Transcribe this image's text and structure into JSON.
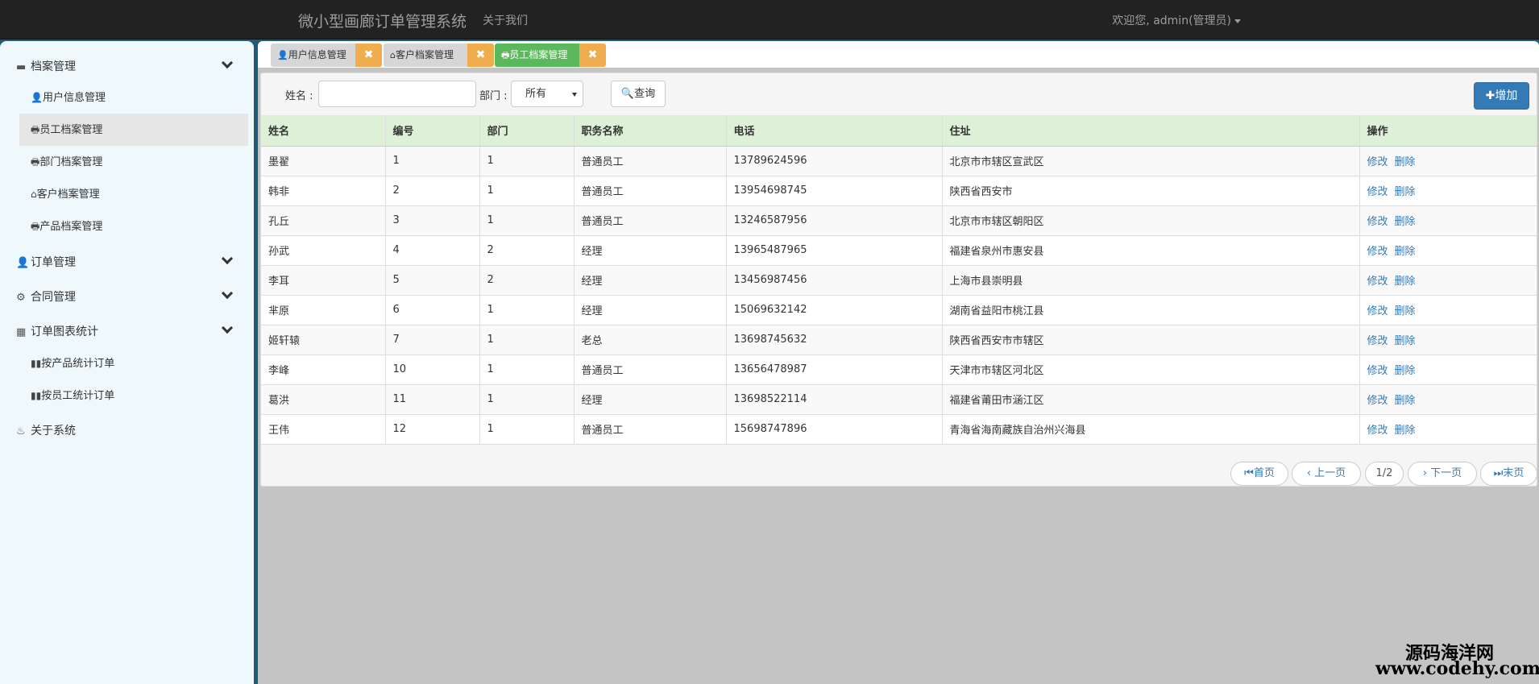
{
  "header": {
    "brand": "微小型画廊订单管理系统",
    "about": "关于我们",
    "user": "欢迎您, admin(管理员)"
  },
  "sidebar": {
    "groups": [
      {
        "icon": "card-icon",
        "label": "档案管理"
      },
      {
        "icon": "user-icon",
        "label": "订单管理"
      },
      {
        "icon": "gear-icon",
        "label": "合同管理"
      },
      {
        "icon": "calendar-icon",
        "label": "订单图表统计"
      },
      {
        "icon": "fire-icon",
        "label": "关于系统"
      }
    ],
    "archive_items": [
      {
        "icon": "user-icon",
        "label": "用户信息管理"
      },
      {
        "icon": "print-icon",
        "label": "员工档案管理"
      },
      {
        "icon": "print-icon",
        "label": "部门档案管理"
      },
      {
        "icon": "home-icon",
        "label": "客户档案管理"
      },
      {
        "icon": "print-icon",
        "label": "产品档案管理"
      }
    ],
    "chart_items": [
      {
        "icon": "stats-icon",
        "label": "按产品统计订单"
      },
      {
        "icon": "stats-icon",
        "label": "按员工统计订单"
      }
    ]
  },
  "tabs": [
    {
      "icon": "user-icon",
      "label": "用户信息管理",
      "close": "✖"
    },
    {
      "icon": "home-icon",
      "label": "客户档案管理",
      "close": "✖"
    },
    {
      "icon": "print-icon",
      "label": "员工档案管理",
      "close": "✖"
    }
  ],
  "search": {
    "name_label": "姓名 :",
    "dept_label": "部门 :",
    "dept_value": "所有",
    "query_label": "查询",
    "add_label": "增加"
  },
  "table": {
    "headers": [
      "姓名",
      "编号",
      "部门",
      "职务名称",
      "电话",
      "住址",
      "操作"
    ],
    "edit_label": "修改",
    "delete_label": "删除",
    "rows": [
      [
        "墨翟",
        "1",
        "1",
        "普通员工",
        "13789624596",
        "北京市市辖区宣武区"
      ],
      [
        "韩非",
        "2",
        "1",
        "普通员工",
        "13954698745",
        "陕西省西安市"
      ],
      [
        "孔丘",
        "3",
        "1",
        "普通员工",
        "13246587956",
        "北京市市辖区朝阳区"
      ],
      [
        "孙武",
        "4",
        "2",
        "经理",
        "13965487965",
        "福建省泉州市惠安县"
      ],
      [
        "李耳",
        "5",
        "2",
        "经理",
        "13456987456",
        "上海市县崇明县"
      ],
      [
        "芈原",
        "6",
        "1",
        "经理",
        "15069632142",
        "湖南省益阳市桃江县"
      ],
      [
        "姬轩辕",
        "7",
        "1",
        "老总",
        "13698745632",
        "陕西省西安市市辖区"
      ],
      [
        "李峰",
        "10",
        "1",
        "普通员工",
        "13656478987",
        "天津市市辖区河北区"
      ],
      [
        "葛洪",
        "11",
        "1",
        "经理",
        "13698522114",
        "福建省莆田市涵江区"
      ],
      [
        "王伟",
        "12",
        "1",
        "普通员工",
        "15698747896",
        "青海省海南藏族自治州兴海县"
      ]
    ]
  },
  "pager": {
    "first": "首页",
    "prev": "上一页",
    "page": "1/2",
    "next": "下一页",
    "last": "末页"
  },
  "watermark": {
    "line1": "源码海洋网",
    "line2": "www.codehy.com"
  }
}
